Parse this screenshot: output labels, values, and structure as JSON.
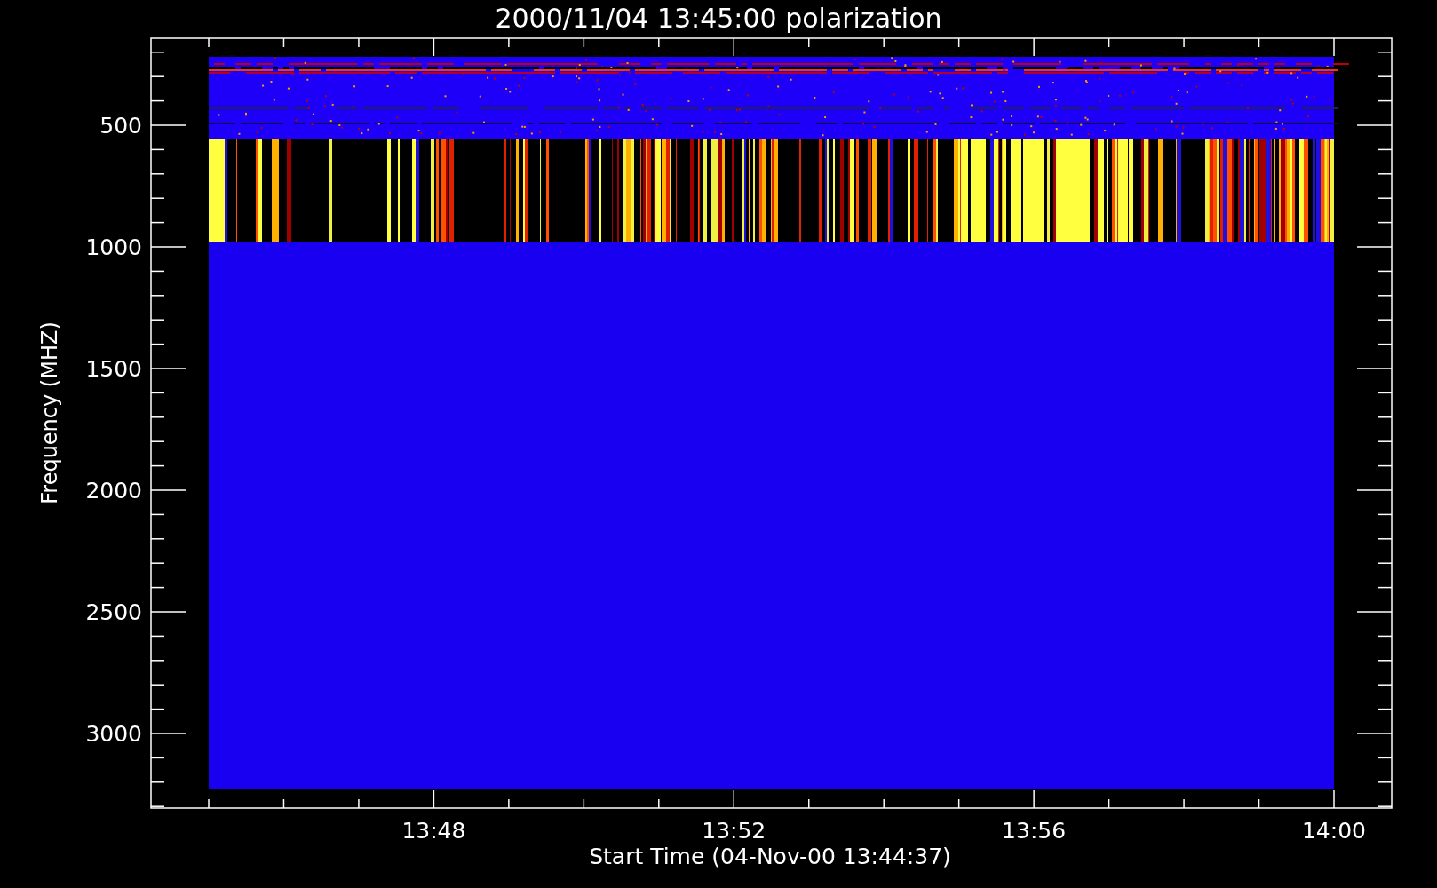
{
  "title": "2000/11/04 13:45:00 polarization",
  "y_axis": {
    "label": "Frequency (MHZ)",
    "ticks": [
      "500",
      "1000",
      "1500",
      "2000",
      "2500",
      "3000"
    ]
  },
  "x_axis": {
    "label": "Start Time (04-Nov-00 13:44:37)",
    "ticks": [
      "13:48",
      "13:52",
      "13:56",
      "14:00"
    ]
  }
}
